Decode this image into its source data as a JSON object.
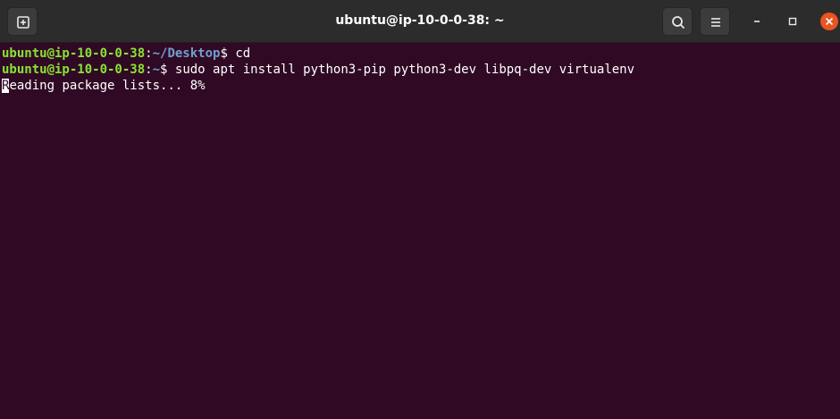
{
  "window": {
    "title": "ubuntu@ip-10-0-0-38: ~"
  },
  "titlebar": {
    "new_tab_icon": "new-tab-icon",
    "search_icon": "search-icon",
    "menu_icon": "hamburger-menu-icon",
    "minimize_icon": "minimize-icon",
    "maximize_icon": "maximize-icon",
    "close_icon": "close-icon"
  },
  "colors": {
    "terminal_bg": "#300a24",
    "prompt_user": "#8ae234",
    "prompt_path": "#729fcf",
    "text": "#ffffff",
    "close_button": "#e95420"
  },
  "terminal": {
    "lines": [
      {
        "user_host": "ubuntu@ip-10-0-0-38",
        "sep": ":",
        "path": "~/Desktop",
        "dollar": "$ ",
        "command": "cd"
      },
      {
        "user_host": "ubuntu@ip-10-0-0-38",
        "sep": ":",
        "path": "~",
        "dollar": "$ ",
        "command": "sudo apt install python3-pip python3-dev libpq-dev virtualenv"
      }
    ],
    "output": {
      "cursor_char": "R",
      "rest": "eading package lists... 8%"
    }
  }
}
